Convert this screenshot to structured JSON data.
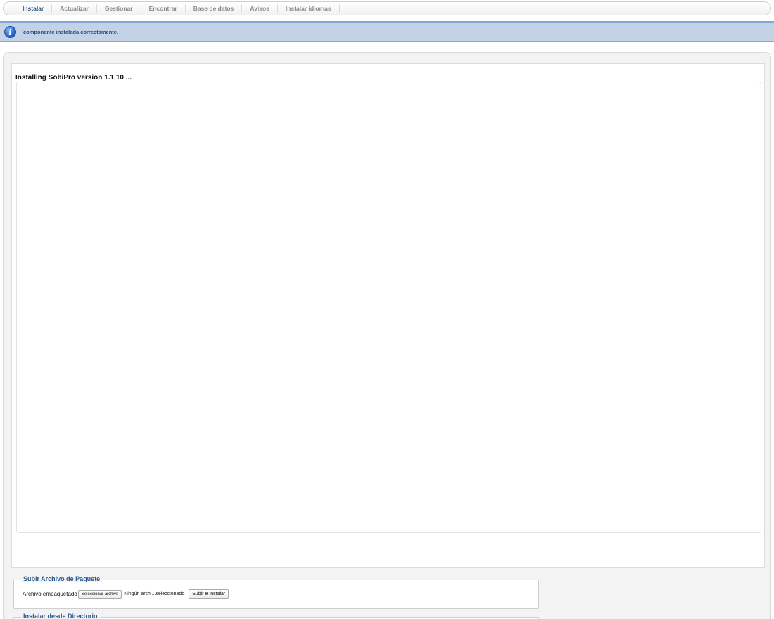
{
  "tabs": [
    {
      "label": "Instalar",
      "active": true
    },
    {
      "label": "Actualizar",
      "active": false
    },
    {
      "label": "Gestionar",
      "active": false
    },
    {
      "label": "Encontrar",
      "active": false
    },
    {
      "label": "Base de datos",
      "active": false
    },
    {
      "label": "Avisos",
      "active": false
    },
    {
      "label": "Instalar idiomas",
      "active": false
    }
  ],
  "message": {
    "icon": "info-icon",
    "text": "componente instalada correctamente."
  },
  "install": {
    "title": "Installing SobiPro version 1.1.10 ..."
  },
  "upload": {
    "legend": "Subir Archivo de Paquete",
    "field_label": "Archivo empaquetado",
    "choose_button": "Seleccionar archivo",
    "file_status": "Ningún archi...seleccionado",
    "submit_button": "Subir e Instalar"
  },
  "directory": {
    "legend": "Instalar desde Directorio"
  },
  "colors": {
    "accent": "#1f4f8a",
    "info_bg": "#c3d2e5",
    "info_border": "#84a7db"
  }
}
